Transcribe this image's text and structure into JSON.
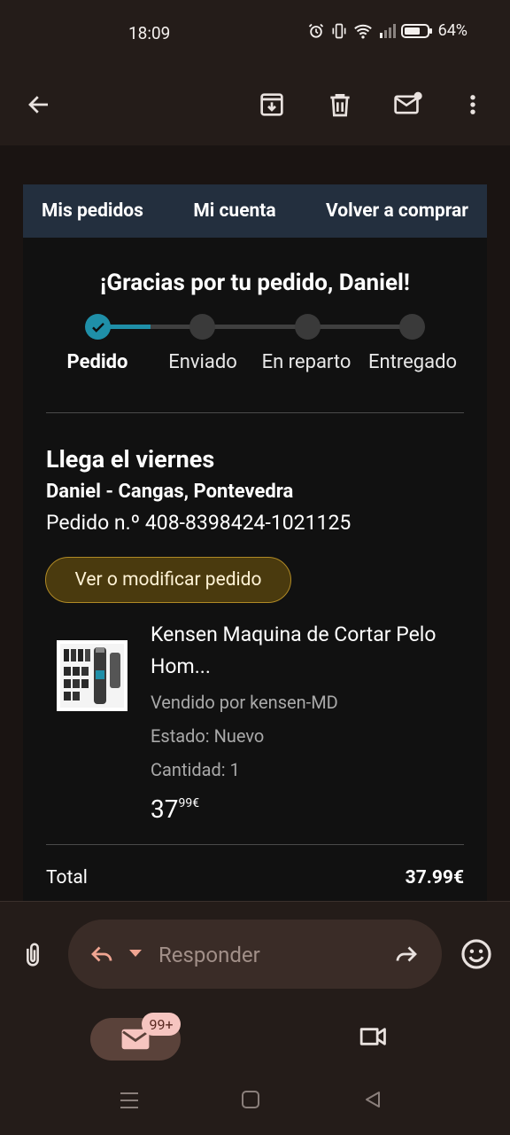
{
  "status": {
    "time": "18:09",
    "battery": "64%"
  },
  "appbar": {
    "back": "back-arrow",
    "archive": "archive",
    "delete": "delete",
    "mark_unread": "mark-unread",
    "more": "more"
  },
  "email": {
    "nav": [
      "Mis pedidos",
      "Mi cuenta",
      "Volver a comprar"
    ],
    "thanks": "¡Gracias por tu pedido, Daniel!",
    "steps": [
      {
        "label": "Pedido",
        "done": true
      },
      {
        "label": "Enviado",
        "done": false
      },
      {
        "label": "En reparto",
        "done": false
      },
      {
        "label": "Entregado",
        "done": false
      }
    ],
    "arrives": "Llega el viernes",
    "recipient": "Daniel - Cangas, Pontevedra",
    "order_number": "Pedido n.º 408-8398424-1021125",
    "modify_button": "Ver o modificar pedido",
    "product": {
      "title": "Kensen Maquina de Cortar Pelo Hom...",
      "seller": "Vendido por kensen-MD",
      "condition": "Estado: Nuevo",
      "quantity": "Cantidad: 1",
      "price_whole": "37",
      "price_fraction": "99€"
    },
    "total_label": "Total",
    "total_value": "37.99€"
  },
  "reply": {
    "placeholder": "Responder"
  },
  "bottom_nav": {
    "badge": "99+"
  },
  "colors": {
    "accent": "#1f8fa8",
    "nav_strip": "#232f3e",
    "button_bg": "#4a3a0e"
  }
}
